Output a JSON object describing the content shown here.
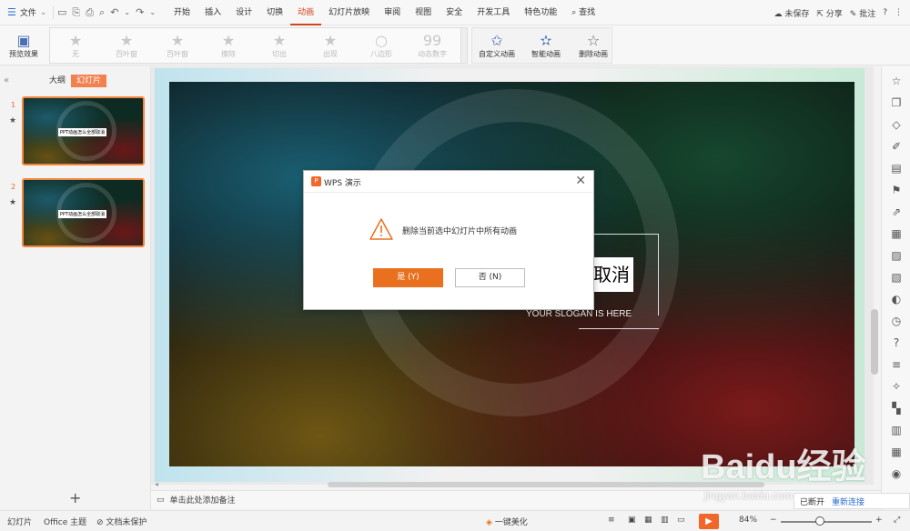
{
  "menubar": {
    "file_label": "文件",
    "tabs": [
      "开始",
      "插入",
      "设计",
      "切换",
      "动画",
      "幻灯片放映",
      "审阅",
      "视图",
      "安全",
      "开发工具",
      "特色功能"
    ],
    "active_tab_index": 4,
    "search_label": "查找",
    "unsaved_label": "未保存",
    "share_label": "分享",
    "comment_label": "批注",
    "help_icon": "?",
    "more_icon": "⋮"
  },
  "ribbon": {
    "preview_label": "预览效果",
    "effects": [
      "无",
      "百叶窗",
      "百叶窗",
      "擦除",
      "切出",
      "出现",
      "八边形",
      "动态数字"
    ],
    "custom_animation_label": "自定义动画",
    "smart_animation_label": "智能动画",
    "delete_animation_label": "删除动画"
  },
  "left_panel": {
    "outline_tab": "大纲",
    "slides_tab": "幻灯片",
    "thumbnails": [
      {
        "number": "1",
        "caption": "PPT动画怎么全部取消"
      },
      {
        "number": "2",
        "caption": "PPT动画怎么全部取消"
      }
    ]
  },
  "slide": {
    "title_text": "取消",
    "slogan": "YOUR SLOGAN IS HERE"
  },
  "notes": {
    "placeholder": "单击此处添加备注"
  },
  "statusbar": {
    "slide_label": "幻灯片",
    "theme_label": "Office 主题",
    "protection_label": "文档未保护",
    "beautify_label": "一键美化",
    "zoom_label": "84%",
    "zoom_percent": 84
  },
  "dialog": {
    "title": "WPS 演示",
    "message": "删除当前选中幻灯片中所有动画",
    "yes_label": "是 (Y)",
    "no_label": "否 (N)"
  },
  "toast": {
    "status": "已断开",
    "link": "重新连接"
  },
  "watermark": {
    "logo": "Baidu经验",
    "url": "jingyan.baidu.com"
  },
  "colors": {
    "accent": "#f1672b",
    "active_tab": "#d2461b",
    "yes_button": "#e8701e",
    "link": "#2d6bd2"
  }
}
